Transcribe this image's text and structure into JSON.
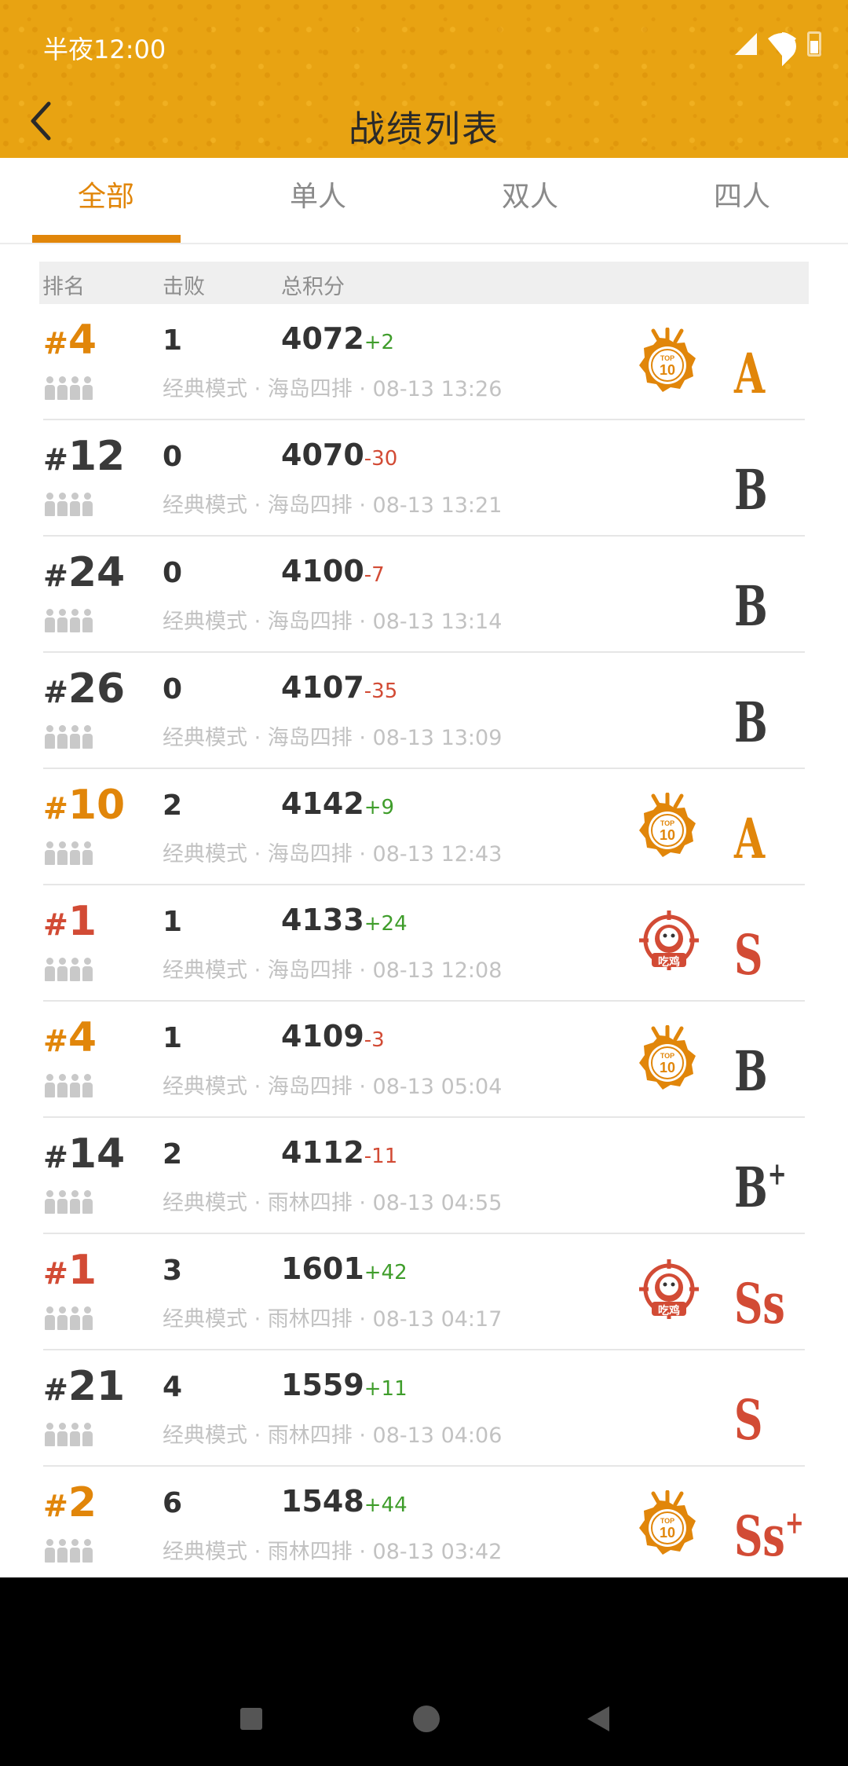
{
  "status_bar": {
    "time": "半夜12:00"
  },
  "header": {
    "title": "战绩列表"
  },
  "tabs": [
    {
      "label": "全部",
      "active": true
    },
    {
      "label": "单人",
      "active": false
    },
    {
      "label": "双人",
      "active": false
    },
    {
      "label": "四人",
      "active": false
    }
  ],
  "columns": {
    "rank": "排名",
    "kills": "击败",
    "score": "总积分"
  },
  "colors": {
    "accent": "#e1860a",
    "header_bg": "#e8a312",
    "red": "#d24b35",
    "green": "#3f9d2b"
  },
  "rows": [
    {
      "hash": "#",
      "rank": "4",
      "rank_color": "orange",
      "kills": "1",
      "score": "4072",
      "delta": "+2",
      "delta_dir": "up",
      "mode": "经典模式 ·",
      "map": "海岛四排 ·",
      "time": "08-13 13:26",
      "badge": "top10",
      "grade": "A",
      "grade_sup": "",
      "grade_color": "orange"
    },
    {
      "hash": "#",
      "rank": "12",
      "rank_color": "dark",
      "kills": "0",
      "score": "4070",
      "delta": "-30",
      "delta_dir": "down",
      "mode": "经典模式 ·",
      "map": "海岛四排 ·",
      "time": "08-13 13:21",
      "badge": "",
      "grade": "B",
      "grade_sup": "",
      "grade_color": "dark"
    },
    {
      "hash": "#",
      "rank": "24",
      "rank_color": "dark",
      "kills": "0",
      "score": "4100",
      "delta": "-7",
      "delta_dir": "down",
      "mode": "经典模式 ·",
      "map": "海岛四排 ·",
      "time": "08-13 13:14",
      "badge": "",
      "grade": "B",
      "grade_sup": "",
      "grade_color": "dark"
    },
    {
      "hash": "#",
      "rank": "26",
      "rank_color": "dark",
      "kills": "0",
      "score": "4107",
      "delta": "-35",
      "delta_dir": "down",
      "mode": "经典模式 ·",
      "map": "海岛四排 ·",
      "time": "08-13 13:09",
      "badge": "",
      "grade": "B",
      "grade_sup": "",
      "grade_color": "dark"
    },
    {
      "hash": "#",
      "rank": "10",
      "rank_color": "orange",
      "kills": "2",
      "score": "4142",
      "delta": "+9",
      "delta_dir": "up",
      "mode": "经典模式 ·",
      "map": "海岛四排 ·",
      "time": "08-13 12:43",
      "badge": "top10",
      "grade": "A",
      "grade_sup": "",
      "grade_color": "orange"
    },
    {
      "hash": "#",
      "rank": "1",
      "rank_color": "red",
      "kills": "1",
      "score": "4133",
      "delta": "+24",
      "delta_dir": "up",
      "mode": "经典模式 ·",
      "map": "海岛四排 ·",
      "time": "08-13 12:08",
      "badge": "chicken",
      "badge_text": "吃鸡",
      "grade": "S",
      "grade_sup": "",
      "grade_color": "red"
    },
    {
      "hash": "#",
      "rank": "4",
      "rank_color": "orange",
      "kills": "1",
      "score": "4109",
      "delta": "-3",
      "delta_dir": "down",
      "mode": "经典模式 ·",
      "map": "海岛四排 ·",
      "time": "08-13 05:04",
      "badge": "top10",
      "grade": "B",
      "grade_sup": "",
      "grade_color": "dark"
    },
    {
      "hash": "#",
      "rank": "14",
      "rank_color": "dark",
      "kills": "2",
      "score": "4112",
      "delta": "-11",
      "delta_dir": "down",
      "mode": "经典模式 ·",
      "map": "雨林四排 ·",
      "time": "08-13 04:55",
      "badge": "",
      "grade": "B",
      "grade_sup": "+",
      "grade_color": "dark"
    },
    {
      "hash": "#",
      "rank": "1",
      "rank_color": "red",
      "kills": "3",
      "score": "1601",
      "delta": "+42",
      "delta_dir": "up",
      "mode": "经典模式 ·",
      "map": "雨林四排 ·",
      "time": "08-13 04:17",
      "badge": "chicken",
      "badge_text": "吃鸡",
      "grade": "Ss",
      "grade_sup": "",
      "grade_color": "red"
    },
    {
      "hash": "#",
      "rank": "21",
      "rank_color": "dark",
      "kills": "4",
      "score": "1559",
      "delta": "+11",
      "delta_dir": "up",
      "mode": "经典模式 ·",
      "map": "雨林四排 ·",
      "time": "08-13 04:06",
      "badge": "",
      "grade": "S",
      "grade_sup": "",
      "grade_color": "red"
    },
    {
      "hash": "#",
      "rank": "2",
      "rank_color": "orange",
      "kills": "6",
      "score": "1548",
      "delta": "+44",
      "delta_dir": "up",
      "mode": "经典模式 ·",
      "map": "雨林四排 ·",
      "time": "08-13 03:42",
      "badge": "top10",
      "grade": "Ss",
      "grade_sup": "+",
      "grade_color": "red"
    }
  ]
}
